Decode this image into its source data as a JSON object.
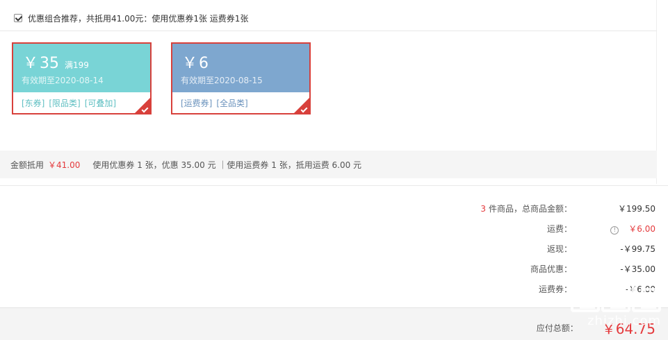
{
  "recommend": {
    "checked": true,
    "text": "优惠组合推荐，共抵用41.00元：使用优惠券1张 运费券1张"
  },
  "coupons": [
    {
      "currency": "￥",
      "value": "35",
      "condition": "满199",
      "validity": "有效期至2020-08-14",
      "tags": [
        "[东券]",
        "[限品类]",
        "[可叠加]"
      ],
      "selected": true,
      "color": "#79d4d6"
    },
    {
      "currency": "￥",
      "value": "6",
      "condition": "",
      "validity": "有效期至2020-08-15",
      "tags": [
        "[运费券]",
        "[全品类]"
      ],
      "selected": true,
      "color": "#7ea7cf"
    }
  ],
  "summary": {
    "label": "金额抵用",
    "amount": "￥41.00",
    "detail": "使用优惠券 1 张，优惠 35.00 元 ｜使用运费券 1 张，抵用运费 6.00 元"
  },
  "totals": {
    "goods_count": "3",
    "goods_label": "件商品，总商品金额：",
    "goods_value": "￥199.50",
    "shipping_label": "运费：",
    "shipping_value": "￥6.00",
    "cashback_label": "返现：",
    "cashback_value": "-￥99.75",
    "discount_label": "商品优惠：",
    "discount_value": "-￥35.00",
    "shipping_coupon_label": "运费券：",
    "shipping_coupon_value": "-￥6.00"
  },
  "payable": {
    "label": "应付总额：",
    "value": "￥64.75"
  },
  "watermark": {
    "site": "zhizhi.com"
  },
  "colors": {
    "accent_red": "#e4393c",
    "coupon_border": "#d8403b",
    "coupon_teal": "#79d4d6",
    "coupon_blue": "#7ea7cf"
  }
}
